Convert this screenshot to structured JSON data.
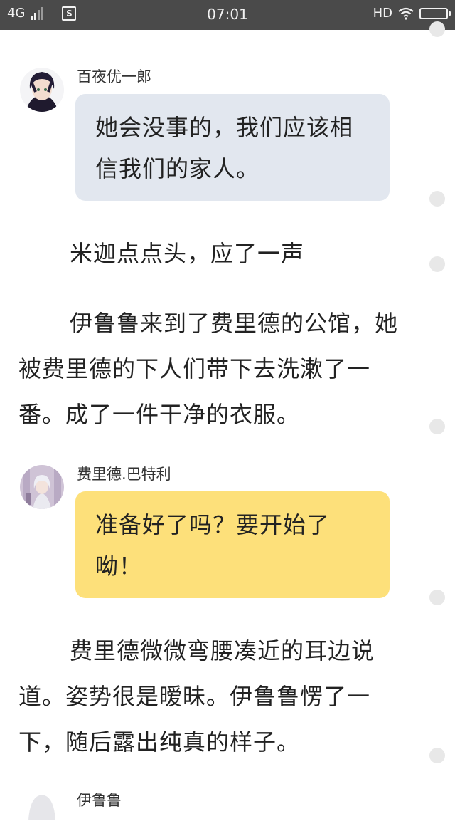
{
  "status_bar": {
    "network": "4G",
    "app_badge": "S",
    "time": "07:01",
    "hd": "HD"
  },
  "chat": [
    {
      "name": "百夜优一郎",
      "bubble": "她会没事的，我们应该相信我们的家人。",
      "bubble_color": "#e2e7ef"
    },
    {
      "name": "费里德.巴特利",
      "bubble": "准备好了吗？要开始了呦！",
      "bubble_color": "#fde07a"
    },
    {
      "name": "伊鲁鲁"
    }
  ],
  "paragraphs": [
    "米迦点点头，应了一声",
    "伊鲁鲁来到了费里德的公馆，她被费里德的下人们带下去洗漱了一番。成了一件干净的衣服。",
    "费里德微微弯腰凑近的耳边说道。姿势很是暧昧。伊鲁鲁愣了一下，随后露出纯真的样子。"
  ]
}
